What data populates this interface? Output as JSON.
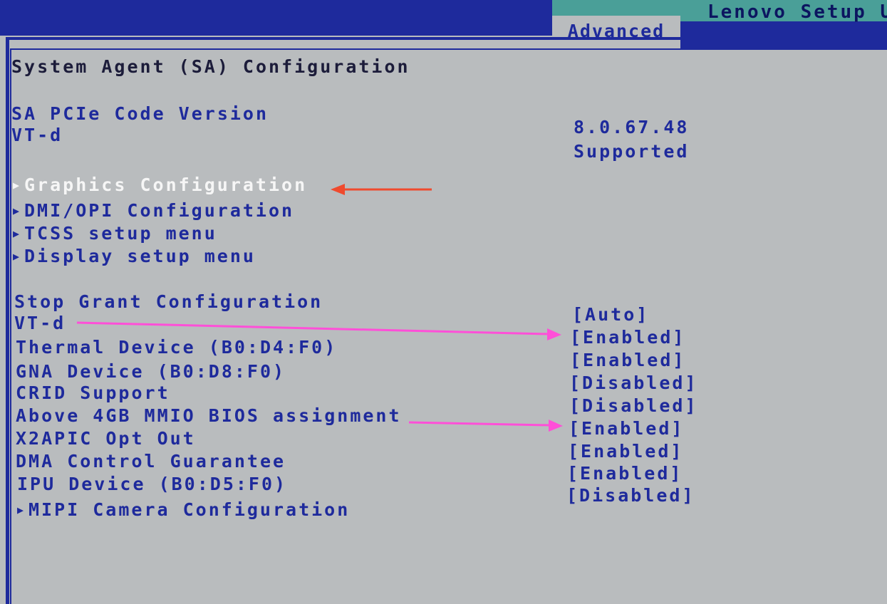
{
  "header": {
    "brand": "Lenovo Setup U",
    "active_tab": "Advanced"
  },
  "page": {
    "title": "System Agent (SA) Configuration"
  },
  "info": [
    {
      "label": "SA PCIe Code Version",
      "value": "8.0.67.48"
    },
    {
      "label": "VT-d",
      "value": "Supported"
    }
  ],
  "submenus": [
    {
      "label": "Graphics Configuration",
      "selected": true
    },
    {
      "label": "DMI/OPI Configuration"
    },
    {
      "label": "TCSS setup menu"
    },
    {
      "label": "Display setup menu"
    }
  ],
  "settings": [
    {
      "label": "Stop Grant Configuration",
      "value": "[Auto]"
    },
    {
      "label": "VT-d",
      "value": "[Enabled]"
    },
    {
      "label": "Thermal Device (B0:D4:F0)",
      "value": "[Enabled]"
    },
    {
      "label": "GNA Device (B0:D8:F0)",
      "value": "[Disabled]"
    },
    {
      "label": "CRID Support",
      "value": "[Disabled]"
    },
    {
      "label": "Above 4GB MMIO BIOS assignment",
      "value": "[Enabled]"
    },
    {
      "label": "X2APIC Opt Out",
      "value": "[Enabled]"
    },
    {
      "label": "DMA Control Guarantee",
      "value": "[Enabled]"
    },
    {
      "label": "IPU Device (B0:D5:F0)",
      "value": "[Disabled]"
    }
  ],
  "submenu_bottom": {
    "label": "MIPI Camera Configuration"
  },
  "icons": {
    "submenu_marker": "triangle-right-icon",
    "annotation": "arrow-icon"
  },
  "colors": {
    "bios_blue": "#1e2a9c",
    "background_gray": "#b9bcbe",
    "highlight_white": "#f6f6f6",
    "annotation_red": "#ef4a2e",
    "annotation_magenta": "#ff4fd8"
  }
}
